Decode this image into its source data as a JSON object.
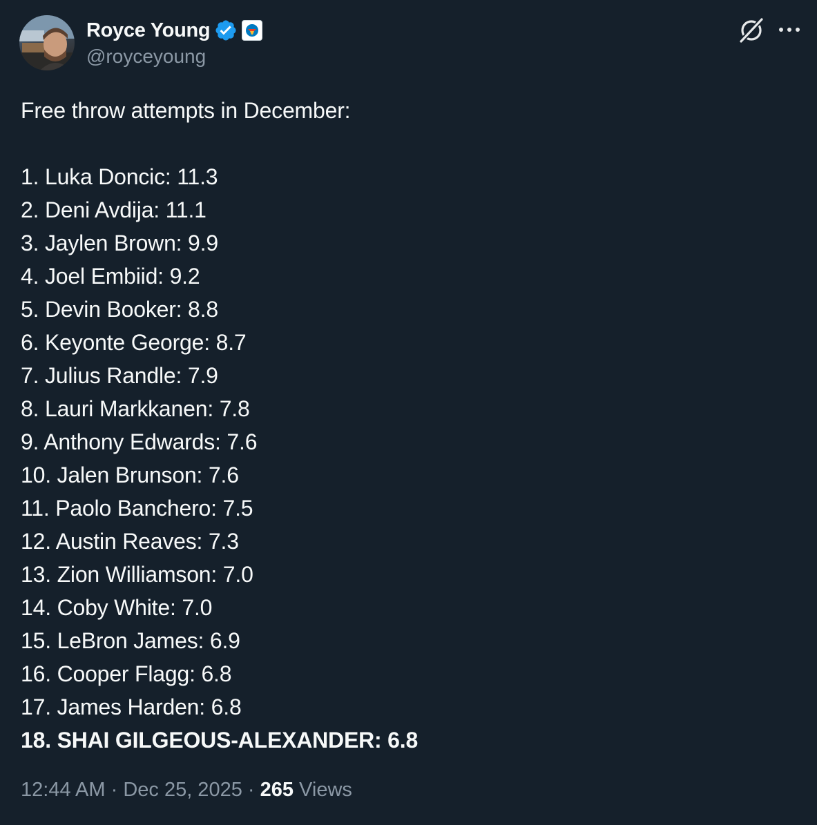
{
  "author": {
    "display_name": "Royce Young",
    "handle": "@royceyoung",
    "verified_icon": "verified-badge-icon",
    "affiliation_icon": "thunder-logo-icon",
    "avatar_icon": "profile-photo"
  },
  "header_actions": {
    "grok_icon": "grok-icon",
    "more_icon": "more-options-icon"
  },
  "tweet": {
    "intro": "Free throw attempts in December:",
    "items": [
      {
        "text": "1. Luka Doncic: 11.3",
        "bold": false
      },
      {
        "text": "2. Deni Avdija: 11.1",
        "bold": false
      },
      {
        "text": "3. Jaylen Brown: 9.9",
        "bold": false
      },
      {
        "text": "4. Joel Embiid: 9.2",
        "bold": false
      },
      {
        "text": "5. Devin Booker: 8.8",
        "bold": false
      },
      {
        "text": "6. Keyonte George: 8.7",
        "bold": false
      },
      {
        "text": "7. Julius Randle: 7.9",
        "bold": false
      },
      {
        "text": "8. Lauri Markkanen: 7.8",
        "bold": false
      },
      {
        "text": "9. Anthony Edwards: 7.6",
        "bold": false
      },
      {
        "text": "10. Jalen Brunson: 7.6",
        "bold": false
      },
      {
        "text": "11. Paolo Banchero: 7.5",
        "bold": false
      },
      {
        "text": "12. Austin Reaves: 7.3",
        "bold": false
      },
      {
        "text": "13. Zion Williamson: 7.0",
        "bold": false
      },
      {
        "text": "14. Coby White: 7.0",
        "bold": false
      },
      {
        "text": "15. LeBron James: 6.9",
        "bold": false
      },
      {
        "text": "16. Cooper Flagg: 6.8",
        "bold": false
      },
      {
        "text": "17. James Harden: 6.8",
        "bold": false
      },
      {
        "text": "18. SHAI GILGEOUS-ALEXANDER: 6.8",
        "bold": true
      }
    ]
  },
  "meta": {
    "time": "12:44 AM",
    "separator": " · ",
    "date": "Dec 25, 2025",
    "views_count": "265",
    "views_label": " Views"
  },
  "colors": {
    "background": "#15202b",
    "text_primary": "#f7f9f9",
    "text_secondary": "#8b98a5",
    "verified_blue": "#1d9bf0"
  }
}
